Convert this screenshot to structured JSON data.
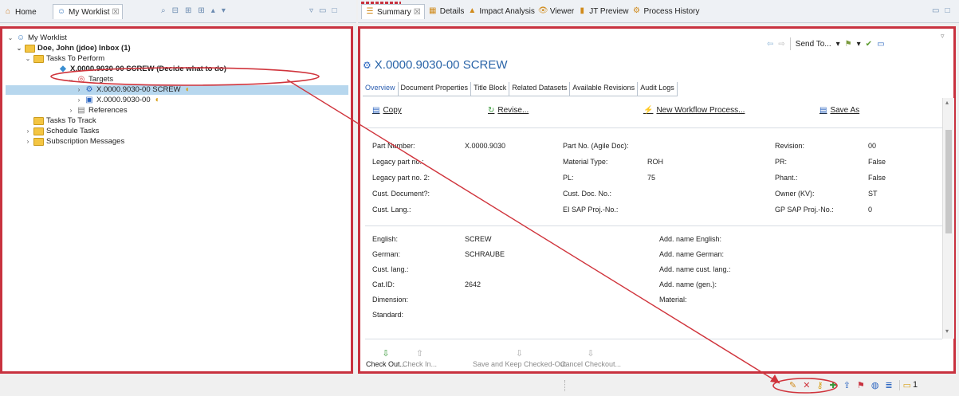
{
  "left_tabs": {
    "home": "Home",
    "worklist": "My Worklist",
    "worklist_close": "☒"
  },
  "right_tabs": [
    {
      "label": "Summary",
      "icon": "summary-icon"
    },
    {
      "label": "Details",
      "icon": "details-icon"
    },
    {
      "label": "Impact Analysis",
      "icon": "impact-analysis-icon"
    },
    {
      "label": "Viewer",
      "icon": "viewer-icon"
    },
    {
      "label": "JT Preview",
      "icon": "jt-preview-icon"
    },
    {
      "label": "Process History",
      "icon": "process-history-icon"
    }
  ],
  "tree": {
    "root": "My Worklist",
    "inbox": "Doe, John (jdoe) Inbox (1)",
    "tasks_to_perform": "Tasks To Perform",
    "task": "X.0000.9030-00 SCREW (Decide what to do)",
    "targets": "Targets",
    "target1": "X.0000.9030-00 SCREW",
    "target2": "X.0000.9030-00",
    "references": "References",
    "tasks_to_track": "Tasks To Track",
    "schedule_tasks": "Schedule Tasks",
    "subscription_messages": "Subscription Messages"
  },
  "summary": {
    "send_to": "Send To...",
    "title": "X.0000.9030-00 SCREW",
    "subtabs": [
      "Overview",
      "Document Properties",
      "Title Block",
      "Related Datasets",
      "Available Revisions",
      "Audit Logs"
    ],
    "actions": {
      "copy": "Copy",
      "revise": "Revise...",
      "new_workflow": "New Workflow Process...",
      "save_as": "Save As"
    },
    "props_a": [
      {
        "label": "Part Number:",
        "value": "X.0000.9030"
      },
      {
        "label": "Legacy part no.:",
        "value": ""
      },
      {
        "label": "Legacy part no. 2:",
        "value": ""
      },
      {
        "label": "Cust. Document?:",
        "value": ""
      },
      {
        "label": "Cust. Lang.:",
        "value": ""
      }
    ],
    "props_b": [
      {
        "label": "Part No. (Agile Doc):",
        "value": ""
      },
      {
        "label": "Material Type:",
        "value": "ROH"
      },
      {
        "label": "PL:",
        "value": "75"
      },
      {
        "label": "Cust. Doc. No.:",
        "value": ""
      },
      {
        "label": "EI SAP Proj.-No.:",
        "value": ""
      }
    ],
    "props_c": [
      {
        "label": "Revision:",
        "value": "00"
      },
      {
        "label": "PR:",
        "value": "False"
      },
      {
        "label": "Phant.:",
        "value": "False"
      },
      {
        "label": "Owner (KV):",
        "value": "ST"
      },
      {
        "label": "GP SAP Proj.-No.:",
        "value": "0"
      }
    ],
    "names_left": [
      {
        "label": "English:",
        "value": "SCREW"
      },
      {
        "label": "German:",
        "value": "SCHRAUBE"
      },
      {
        "label": "Cust. lang.:",
        "value": ""
      },
      {
        "label": "Cat.ID:",
        "value": "2642"
      },
      {
        "label": "Dimension:",
        "value": ""
      },
      {
        "label": "Standard:",
        "value": ""
      }
    ],
    "names_right": [
      {
        "label": "Add. name English:"
      },
      {
        "label": "Add. name German:"
      },
      {
        "label": "Add. name cust. lang.:"
      },
      {
        "label": "Add. name (gen.):"
      },
      {
        "label": "Material:"
      }
    ],
    "bottom_buttons": [
      "Check Out...",
      "Check In...",
      "Save and Keep Checked-Out",
      "Cancel Checkout..."
    ]
  },
  "status": {
    "count": "1"
  },
  "colors": {
    "accent_red": "#c8323f",
    "selection": "#b7d7ee",
    "link_blue": "#2a5db0"
  }
}
